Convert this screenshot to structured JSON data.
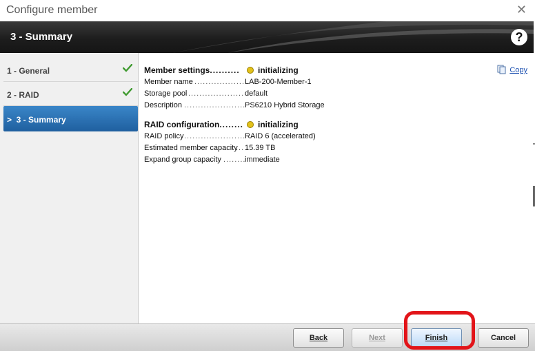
{
  "window": {
    "title": "Configure member",
    "close_glyph": "✕"
  },
  "header": {
    "title": "3 - Summary",
    "help_glyph": "?"
  },
  "sidebar": {
    "items": [
      {
        "label": "1 - General",
        "state": "done"
      },
      {
        "label": "2 - RAID",
        "state": "done"
      },
      {
        "label": ">  3 - Summary",
        "state": "active"
      }
    ]
  },
  "summary": {
    "copy_label": "Copy",
    "member_settings": {
      "heading": "Member settings",
      "status": "initializing",
      "rows": [
        {
          "key": "Member name",
          "value": "LAB-200-Member-1"
        },
        {
          "key": "Storage pool",
          "value": "default"
        },
        {
          "key": "Description",
          "value": "PS6210 Hybrid Storage"
        }
      ]
    },
    "raid_configuration": {
      "heading": "RAID configuration",
      "status": "initializing",
      "rows": [
        {
          "key": "RAID policy",
          "value": "RAID 6 (accelerated)"
        },
        {
          "key": "Estimated member capacity",
          "value": "15.39 TB"
        },
        {
          "key": "Expand group capacity",
          "value": "immediate"
        }
      ]
    }
  },
  "footer": {
    "back_label": "Back",
    "next_label": "Next",
    "finish_label": "Finish",
    "cancel_label": "Cancel"
  },
  "colors": {
    "accent": "#1f5f9f",
    "status_dot": "#e3c21b",
    "highlight": "#e21419"
  }
}
